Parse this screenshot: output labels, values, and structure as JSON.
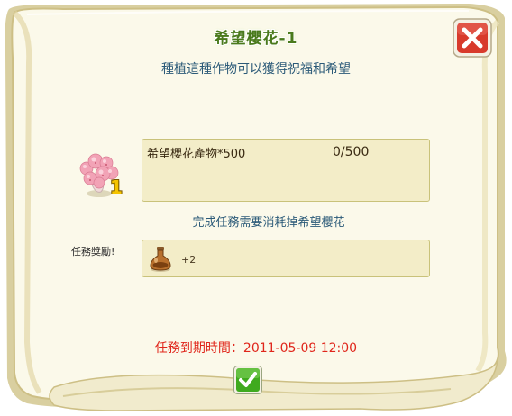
{
  "dialog": {
    "title": "希望櫻花-1",
    "subtitle": "種植這種作物可以獲得祝福和希望"
  },
  "requirement": {
    "item_icon": "sakura-flower-icon",
    "item_badge": "1",
    "label": "希望櫻花產物*500",
    "progress": "0/500"
  },
  "note": "完成任務需要消耗掉希望櫻花",
  "reward": {
    "label": "任務獎勵!",
    "icon": "potion-flask-icon",
    "amount": "+2"
  },
  "deadline": "任務到期時間：2011-05-09 12:00",
  "buttons": {
    "close_icon": "close-icon",
    "confirm_icon": "checkmark-icon"
  },
  "colors": {
    "title": "#4a7a1c",
    "text_blue": "#2b5a78",
    "deadline_red": "#e0261b",
    "close_red": "#d83a2c",
    "confirm_green": "#3faa1e",
    "panel_bg": "#f3edc8",
    "paper": "#fdfbef"
  }
}
